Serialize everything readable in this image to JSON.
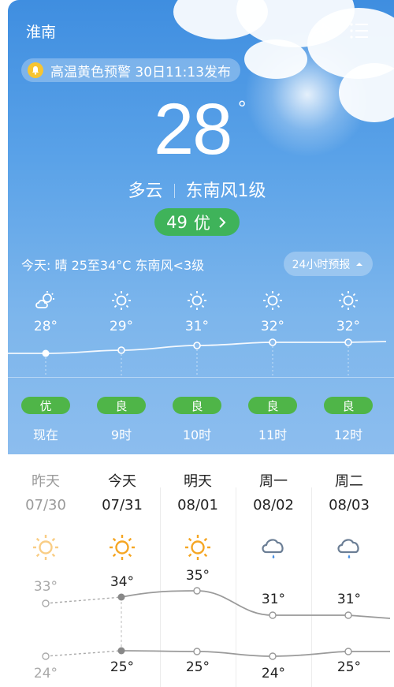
{
  "header": {
    "city": "淮南",
    "share_icon": "share-icon",
    "menu_icon": "list-menu-icon"
  },
  "alert": {
    "icon": "bell-icon",
    "text": "高温黄色预警 30日11:13发布"
  },
  "current": {
    "temperature": "28",
    "degree_symbol": "°",
    "condition": "多云",
    "wind": "东南风1级",
    "aqi_value": "49",
    "aqi_level": "优",
    "aqi_color": "#3fb35a"
  },
  "today_summary": "今天: 晴 25至34°C 东南风<3级",
  "forecast_button": "24小时预报",
  "hourly": [
    {
      "icon": "partly-cloudy-sun-icon",
      "temp": "28°",
      "aq": "优",
      "time": "现在"
    },
    {
      "icon": "sun-icon",
      "temp": "29°",
      "aq": "良",
      "time": "9时"
    },
    {
      "icon": "sun-icon",
      "temp": "31°",
      "aq": "良",
      "time": "10时"
    },
    {
      "icon": "sun-icon",
      "temp": "32°",
      "aq": "良",
      "time": "11时"
    },
    {
      "icon": "sun-icon",
      "temp": "32°",
      "aq": "良",
      "time": "12时"
    }
  ],
  "daily": [
    {
      "name": "昨天",
      "date": "07/30",
      "icon": "sun-icon",
      "high": "33°",
      "low": "24°",
      "past": true
    },
    {
      "name": "今天",
      "date": "07/31",
      "icon": "sun-icon",
      "high": "34°",
      "low": "25°",
      "past": false
    },
    {
      "name": "明天",
      "date": "08/01",
      "icon": "sun-icon",
      "high": "35°",
      "low": "25°",
      "past": false
    },
    {
      "name": "周一",
      "date": "08/02",
      "icon": "rain-cloud-icon",
      "high": "31°",
      "low": "24°",
      "past": false
    },
    {
      "name": "周二",
      "date": "08/03",
      "icon": "rain-cloud-icon",
      "high": "31°",
      "low": "25°",
      "past": false
    }
  ],
  "colors": {
    "sky_top": "#3f8ee0",
    "sky_bottom": "#8cbdee",
    "aq_good": "#4fb548",
    "sun_orange": "#f5a623",
    "rain_blue": "#4a90e2"
  }
}
